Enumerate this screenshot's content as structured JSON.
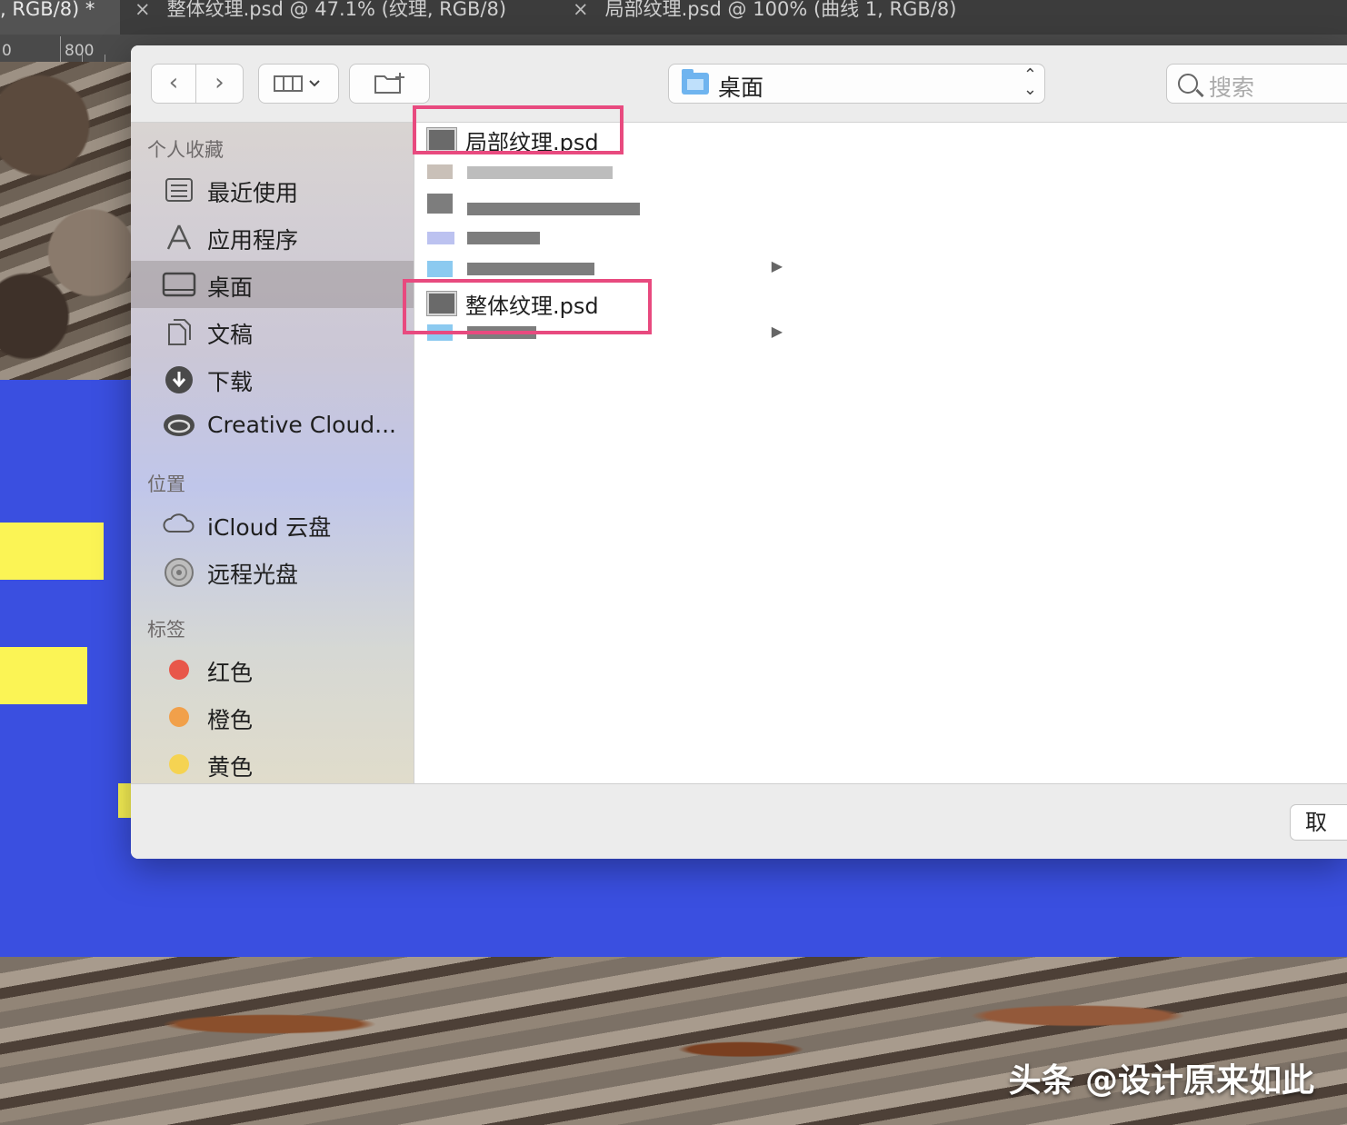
{
  "ps": {
    "tabs": [
      {
        "label": ", RGB/8) *"
      },
      {
        "label": "整体纹理.psd @ 47.1% (纹理, RGB/8)"
      },
      {
        "label": "局部纹理.psd @ 100% (曲线 1, RGB/8)"
      }
    ],
    "ruler": {
      "left_label": "0",
      "mark_label": "800"
    },
    "watermark": "头条 @设计原来如此"
  },
  "dialog": {
    "location": "桌面",
    "search_placeholder": "搜索",
    "sidebar": {
      "favorites_header": "个人收藏",
      "favorites": [
        {
          "label": "最近使用",
          "icon": "recents-icon"
        },
        {
          "label": "应用程序",
          "icon": "applications-icon"
        },
        {
          "label": "桌面",
          "icon": "desktop-icon",
          "selected": true
        },
        {
          "label": "文稿",
          "icon": "documents-icon"
        },
        {
          "label": "下载",
          "icon": "downloads-icon"
        },
        {
          "label": "Creative Cloud...",
          "icon": "creative-cloud-icon"
        }
      ],
      "locations_header": "位置",
      "locations": [
        {
          "label": "iCloud 云盘",
          "icon": "icloud-icon"
        },
        {
          "label": "远程光盘",
          "icon": "remote-disc-icon"
        }
      ],
      "tags_header": "标签",
      "tags": [
        {
          "label": "红色",
          "color": "#e8574a"
        },
        {
          "label": "橙色",
          "color": "#f1a04a"
        },
        {
          "label": "黄色",
          "color": "#f5d352"
        }
      ]
    },
    "files": [
      {
        "name": "局部纹理.psd",
        "highlighted": true
      },
      {
        "name": "整体纹理.psd",
        "highlighted": true
      }
    ],
    "cancel_label": "取"
  }
}
